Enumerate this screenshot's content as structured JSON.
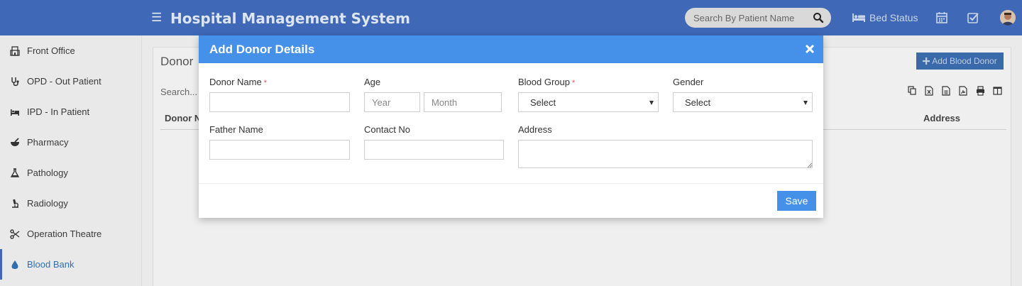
{
  "header": {
    "title": "Hospital Management System",
    "search_placeholder": "Search By Patient Name",
    "bed_status_label": "Bed Status"
  },
  "sidebar": {
    "items": [
      {
        "label": "Front Office",
        "icon": "building-icon"
      },
      {
        "label": "OPD - Out Patient",
        "icon": "stethoscope-icon"
      },
      {
        "label": "IPD - In Patient",
        "icon": "bed-icon"
      },
      {
        "label": "Pharmacy",
        "icon": "mortar-pestle-icon"
      },
      {
        "label": "Pathology",
        "icon": "flask-icon"
      },
      {
        "label": "Radiology",
        "icon": "microscope-icon"
      },
      {
        "label": "Operation Theatre",
        "icon": "scissors-icon"
      },
      {
        "label": "Blood Bank",
        "icon": "blood-drop-icon",
        "active": true
      }
    ]
  },
  "content": {
    "title": "Donor",
    "add_button_label": "Add Blood Donor",
    "search_placeholder": "Search...",
    "col_left": "Donor N",
    "col_right": "Address"
  },
  "modal": {
    "title": "Add Donor Details",
    "donor_name_label": "Donor Name",
    "age_label": "Age",
    "year_placeholder": "Year",
    "month_placeholder": "Month",
    "blood_group_label": "Blood Group",
    "blood_group_value": "Select",
    "gender_label": "Gender",
    "gender_value": "Select",
    "father_name_label": "Father Name",
    "contact_no_label": "Contact No",
    "address_label": "Address",
    "required_mark": "*",
    "save_label": "Save"
  },
  "colors": {
    "header_bg": "#3f69b7",
    "modal_header_bg": "#4591e9",
    "active_item": "#2f6fb0",
    "required": "#d9534f"
  }
}
